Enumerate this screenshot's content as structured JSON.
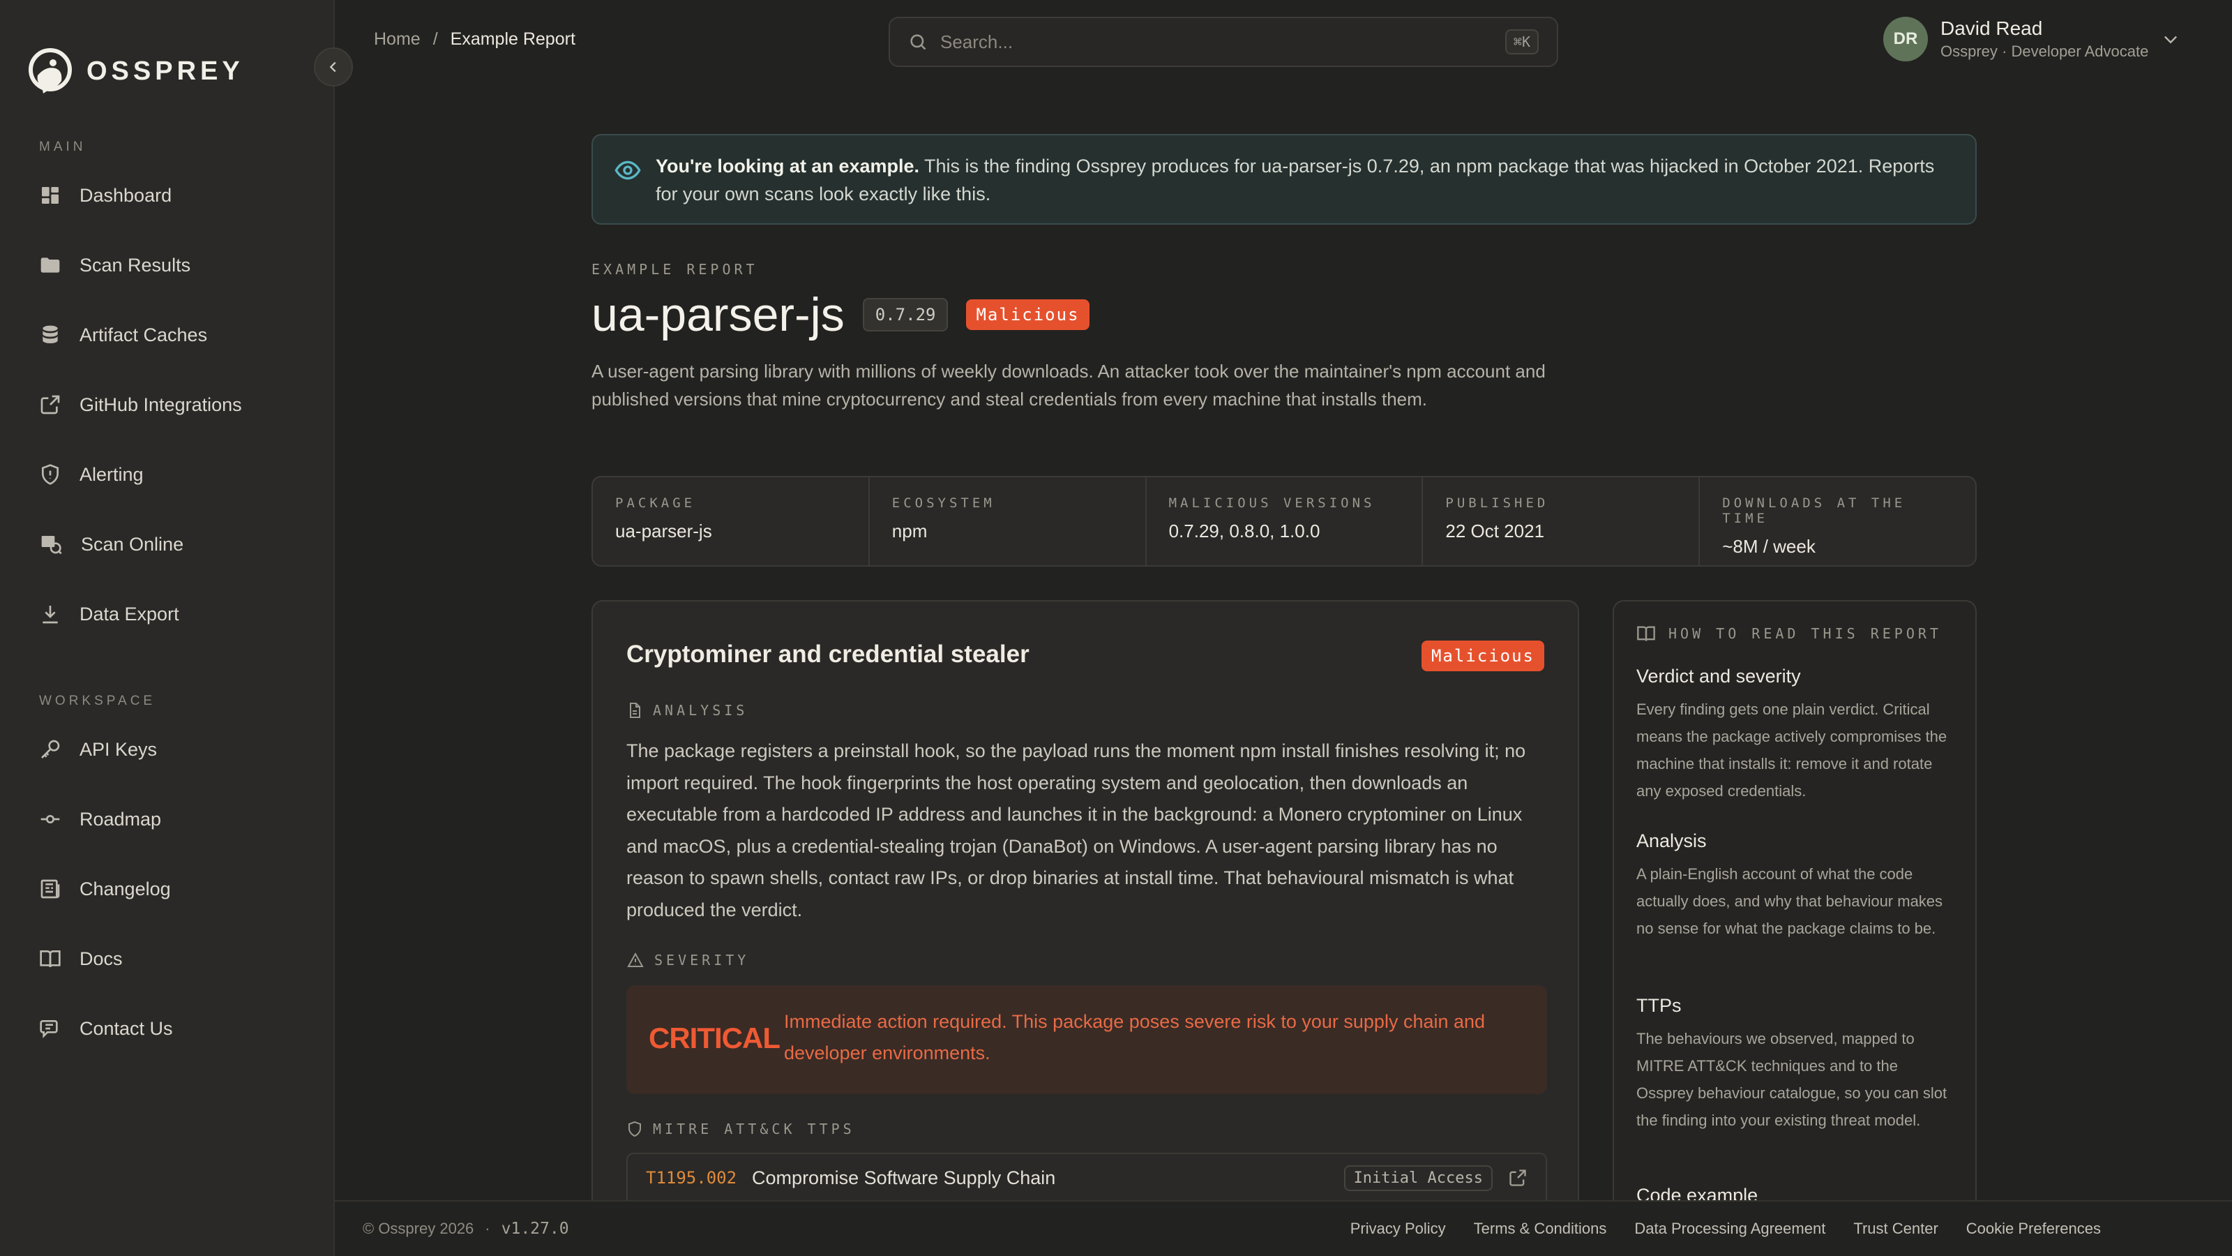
{
  "brand": {
    "name": "OSSPREY"
  },
  "sidebar": {
    "main_label": "MAIN",
    "workspace_label": "WORKSPACE",
    "main_items": [
      {
        "label": "Dashboard",
        "icon": "dashboard-icon"
      },
      {
        "label": "Scan Results",
        "icon": "folder-icon"
      },
      {
        "label": "Artifact Caches",
        "icon": "database-icon"
      },
      {
        "label": "GitHub Integrations",
        "icon": "external-link-icon"
      },
      {
        "label": "Alerting",
        "icon": "shield-icon"
      },
      {
        "label": "Scan Online",
        "icon": "scan-online-icon"
      },
      {
        "label": "Data Export",
        "icon": "download-icon"
      }
    ],
    "workspace_items": [
      {
        "label": "API Keys",
        "icon": "key-icon"
      },
      {
        "label": "Roadmap",
        "icon": "commit-icon"
      },
      {
        "label": "Changelog",
        "icon": "newspaper-icon"
      },
      {
        "label": "Docs",
        "icon": "book-icon"
      },
      {
        "label": "Contact Us",
        "icon": "chat-icon"
      }
    ]
  },
  "header": {
    "breadcrumb": {
      "home": "Home",
      "sep": "/",
      "current": "Example Report"
    },
    "search": {
      "placeholder": "Search...",
      "shortcut": "⌘K"
    },
    "user": {
      "initials": "DR",
      "name": "David Read",
      "role": "Ossprey · Developer Advocate"
    }
  },
  "banner": {
    "strong": "You're looking at an example.",
    "text": " This is the finding Ossprey produces for ua-parser-js 0.7.29, an npm package that was hijacked in October 2021. Reports for your own scans look exactly like this."
  },
  "report": {
    "eyebrow": "EXAMPLE REPORT",
    "title": "ua-parser-js",
    "version": "0.7.29",
    "verdict": "Malicious",
    "description": "A user-agent parsing library with millions of weekly downloads. An attacker took over the maintainer's npm account and published versions that mine cryptocurrency and steal credentials from every machine that installs them."
  },
  "meta": [
    {
      "label": "PACKAGE",
      "value": "ua-parser-js"
    },
    {
      "label": "ECOSYSTEM",
      "value": "npm"
    },
    {
      "label": "MALICIOUS VERSIONS",
      "value": "0.7.29, 0.8.0, 1.0.0"
    },
    {
      "label": "PUBLISHED",
      "value": "22 Oct 2021"
    },
    {
      "label": "DOWNLOADS AT THE TIME",
      "value": "~8M / week"
    }
  ],
  "finding": {
    "title": "Cryptominer and credential stealer",
    "verdict": "Malicious",
    "analysis_label": "ANALYSIS",
    "analysis": "The package registers a preinstall hook, so the payload runs the moment npm install finishes resolving it; no import required. The hook fingerprints the host operating system and geolocation, then downloads an executable from a hardcoded IP address and launches it in the background: a Monero cryptominer on Linux and macOS, plus a credential-stealing trojan (DanaBot) on Windows. A user-agent parsing library has no reason to spawn shells, contact raw IPs, or drop binaries at install time. That behavioural mismatch is what produced the verdict.",
    "severity_label": "SEVERITY",
    "severity_level": "CRITICAL",
    "severity_text": "Immediate action required. This package poses severe risk to your supply chain and developer environments.",
    "ttps_label": "MITRE ATT&CK TTPS",
    "ttps": [
      {
        "id": "T1195.002",
        "name": "Compromise Software Supply Chain",
        "tactic": "Initial Access"
      }
    ]
  },
  "guide": {
    "label": "HOW TO READ THIS REPORT",
    "sections": [
      {
        "title": "Verdict and severity",
        "text": "Every finding gets one plain verdict. Critical means the package actively compromises the machine that installs it: remove it and rotate any exposed credentials."
      },
      {
        "title": "Analysis",
        "text": "A plain-English account of what the code actually does, and why that behaviour makes no sense for what the package claims to be."
      },
      {
        "title": "TTPs",
        "text": "The behaviours we observed, mapped to MITRE ATT&CK techniques and to the Ossprey behaviour catalogue, so you can slot the finding into your existing threat model."
      },
      {
        "title": "Code example",
        "text": ""
      }
    ]
  },
  "footer": {
    "copyright": "© Ossprey 2026",
    "dot": "·",
    "version": "v1.27.0",
    "links": [
      "Privacy Policy",
      "Terms & Conditions",
      "Data Processing Agreement",
      "Trust Center",
      "Cookie Preferences"
    ]
  },
  "colors": {
    "accent": "#e6512d",
    "critical": "#ef5a33",
    "ttp_id": "#e08b3b",
    "background": "#222220",
    "sidebar": "#2a2927"
  }
}
